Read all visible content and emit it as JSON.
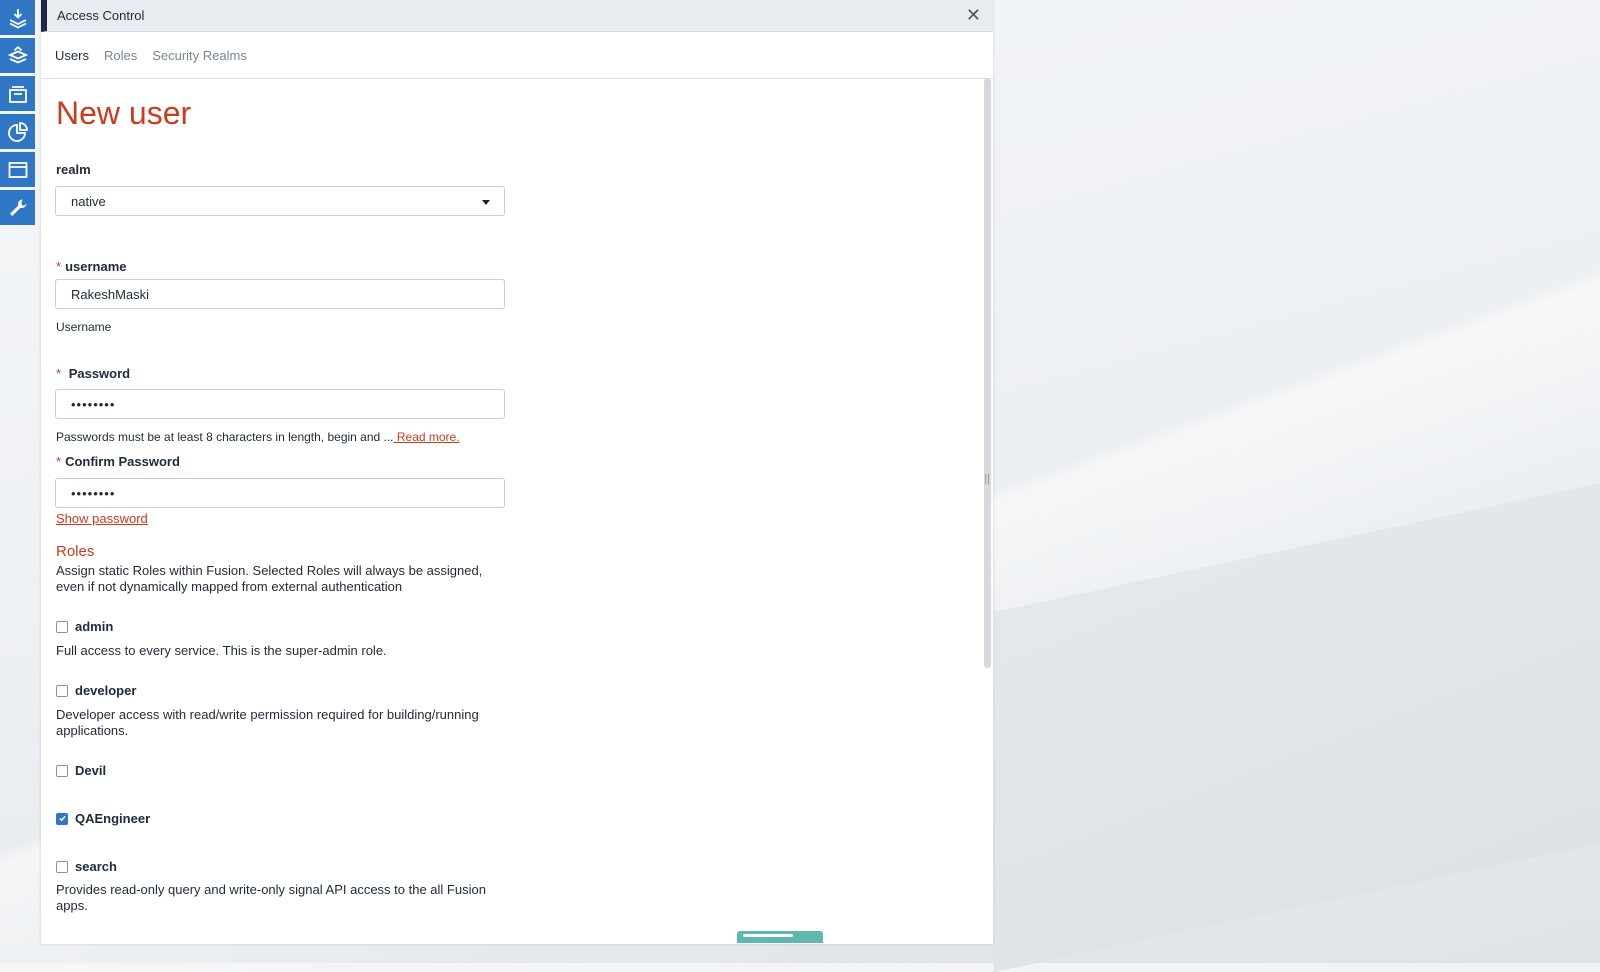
{
  "window": {
    "title": "Access Control"
  },
  "tabs": [
    {
      "label": "Users",
      "active": true
    },
    {
      "label": "Roles",
      "active": false
    },
    {
      "label": "Security Realms",
      "active": false
    }
  ],
  "sidebar": {
    "icons": [
      "download-stack-icon",
      "layers-upload-icon",
      "layers-icon",
      "pie-chart-icon",
      "window-icon",
      "wrench-icon"
    ]
  },
  "form": {
    "heading": "New user",
    "realm": {
      "label": "realm",
      "value": "native"
    },
    "username": {
      "label": "username",
      "value": "RakeshMaski",
      "help": "Username"
    },
    "password": {
      "label": "Password",
      "value": "••••••••",
      "help": "Passwords must be at least 8 characters in length, begin and ...",
      "read_more": " Read more."
    },
    "confirm_password": {
      "label": "Confirm Password",
      "value": "••••••••"
    },
    "show_password": "Show password"
  },
  "roles": {
    "title": "Roles",
    "description": "Assign static Roles within Fusion. Selected Roles will always be assigned, even if not dynamically mapped from external authentication",
    "items": [
      {
        "name": "admin",
        "checked": false,
        "description": "Full access to every service. This is the super-admin role."
      },
      {
        "name": "developer",
        "checked": false,
        "description": "Developer access with read/write permission required for building/running applications."
      },
      {
        "name": "Devil",
        "checked": false,
        "description": ""
      },
      {
        "name": "QAEngineer",
        "checked": true,
        "description": ""
      },
      {
        "name": "search",
        "checked": false,
        "description": "Provides read-only query and write-only signal API access to the all Fusion apps."
      }
    ]
  },
  "colors": {
    "accent": "#cc3b1b",
    "sidebar": "#2f76c4",
    "titlebar_edge": "#1c2740"
  }
}
